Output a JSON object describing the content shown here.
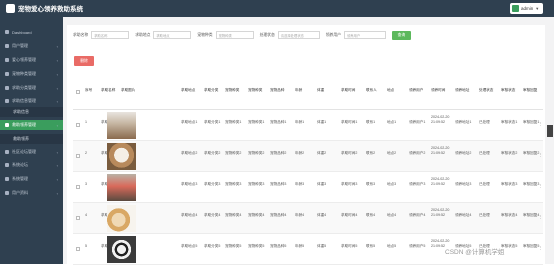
{
  "app": {
    "title": "宠物爱心领养救助系统",
    "user": "admin"
  },
  "colors": {
    "sidebar": "#2f4050",
    "active": "#3a9d5d",
    "search_btn": "#5cb85c",
    "delete_btn": "#e96b66"
  },
  "sidebar": {
    "items": [
      {
        "label": "Dashboard",
        "icon": "home-icon",
        "expandable": false
      },
      {
        "label": "用户管理",
        "icon": "user-icon",
        "expandable": true
      },
      {
        "label": "爱心领养管理",
        "icon": "heart-icon",
        "expandable": true
      },
      {
        "label": "宠物种类管理",
        "icon": "list-icon",
        "expandable": true
      },
      {
        "label": "求助分类管理",
        "icon": "tag-icon",
        "expandable": true
      },
      {
        "label": "求助信息管理",
        "icon": "info-icon",
        "expandable": true
      },
      {
        "label": "求助信息",
        "icon": "",
        "expandable": false
      },
      {
        "label": "救助领养管理",
        "icon": "hand-icon",
        "expandable": true,
        "active": true
      },
      {
        "label": "救助领养",
        "icon": "",
        "expandable": false
      },
      {
        "label": "社区论坛管理",
        "icon": "chat-icon",
        "expandable": true
      },
      {
        "label": "系统论坛",
        "icon": "forum-icon",
        "expandable": true
      },
      {
        "label": "系统管理",
        "icon": "gear-icon",
        "expandable": true
      },
      {
        "label": "用户资料",
        "icon": "profile-icon",
        "expandable": true
      }
    ]
  },
  "search": {
    "fields": [
      {
        "label": "求助名称",
        "placeholder": "求助名称"
      },
      {
        "label": "求助地点",
        "placeholder": "求助地点"
      },
      {
        "label": "宠物种类",
        "placeholder": "宠物种类"
      },
      {
        "label": "处理状态",
        "placeholder": "请选择处理状态"
      },
      {
        "label": "领养用户",
        "placeholder": "领养用户"
      }
    ],
    "button": "查询"
  },
  "toolbar": {
    "delete": "删除"
  },
  "table": {
    "headers": [
      "序号",
      "求助名称",
      "求助图片",
      "求助地点",
      "求助分类",
      "宠物种类",
      "宠物种类",
      "宠物品种",
      "年龄",
      "体重",
      "求助时间",
      "联系人",
      "地点",
      "领养用户",
      "领养时间",
      "领养地址",
      "处理状态",
      "审核状态",
      "审核回复",
      "操作"
    ],
    "rows": [
      {
        "index": "1",
        "name": "求助名称1",
        "loc": "求助地点1",
        "cat": "求助分类1",
        "type": "宠物种类1",
        "breed1": "宠物种类1",
        "breed2": "宠物品种1",
        "age": "年龄1",
        "weight": "体重1",
        "time": "求助时间1",
        "contact": "联系1",
        "place": "地点1",
        "user": "领养用户1",
        "date": "2024-02-20 21:09:52",
        "addr": "领养地址1",
        "status": "已处理",
        "audit": "审核状态1",
        "reply": "审核回复1",
        "thumb": "dog"
      },
      {
        "index": "2",
        "name": "求助名称2",
        "loc": "求助地点2",
        "cat": "求助分类2",
        "type": "宠物种类2",
        "breed1": "宠物种类2",
        "breed2": "宠物品种2",
        "age": "年龄2",
        "weight": "体重2",
        "time": "求助时间2",
        "contact": "联系2",
        "place": "地点2",
        "user": "领养用户2",
        "date": "2024-02-20 21:09:52",
        "addr": "领养地址2",
        "status": "已处理",
        "audit": "审核状态2",
        "reply": "审核回复2",
        "thumb": "dog2"
      },
      {
        "index": "3",
        "name": "求助名称3",
        "loc": "求助地点3",
        "cat": "求助分类3",
        "type": "宠物种类3",
        "breed1": "宠物种类3",
        "breed2": "宠物品种3",
        "age": "年龄3",
        "weight": "体重3",
        "time": "求助时间3",
        "contact": "联系3",
        "place": "地点3",
        "user": "领养用户3",
        "date": "2024-02-20 21:09:52",
        "addr": "领养地址3",
        "status": "已处理",
        "audit": "审核状态3",
        "reply": "审核回复3",
        "thumb": "toy"
      },
      {
        "index": "4",
        "name": "求助名称4",
        "loc": "求助地点4",
        "cat": "求助分类4",
        "type": "宠物种类4",
        "breed1": "宠物种类4",
        "breed2": "宠物品种4",
        "age": "年龄4",
        "weight": "体重4",
        "time": "求助时间4",
        "contact": "联系4",
        "place": "地点4",
        "user": "领养用户4",
        "date": "2024-02-20 21:09:52",
        "addr": "领养地址4",
        "status": "已处理",
        "audit": "审核状态4",
        "reply": "审核回复4",
        "thumb": "cats"
      },
      {
        "index": "5",
        "name": "求助名称5",
        "loc": "求助地点5",
        "cat": "求助分类5",
        "type": "宠物种类5",
        "breed1": "宠物种类5",
        "breed2": "宠物品种5",
        "age": "年龄5",
        "weight": "体重5",
        "time": "求助时间5",
        "contact": "联系5",
        "place": "地点5",
        "user": "领养用户5",
        "date": "2024-02-20 21:09:52",
        "addr": "领养地址5",
        "status": "已处理",
        "audit": "审核状态5",
        "reply": "审核回复5",
        "thumb": "panda"
      }
    ]
  },
  "watermark": "CSDN @计算机学姐"
}
